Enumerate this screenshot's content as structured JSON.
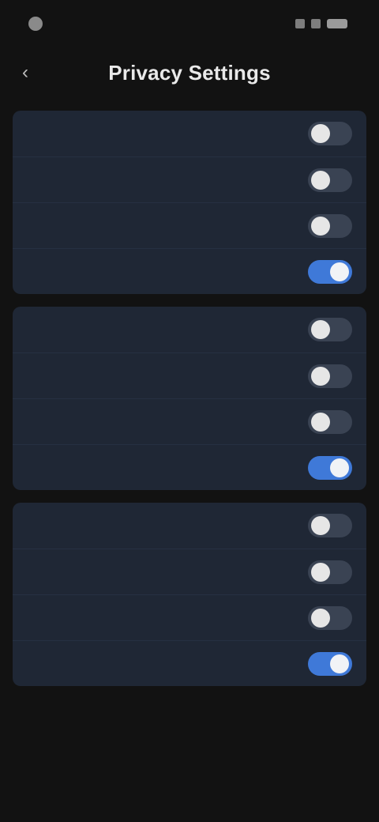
{
  "status_bar": {
    "time": "",
    "right_text": ""
  },
  "header": {
    "title": "Privacy Settings"
  },
  "sections": [
    {
      "title": "",
      "items": [
        {
          "label": "",
          "on": false
        },
        {
          "label": "",
          "on": false
        },
        {
          "label": "",
          "on": false
        },
        {
          "label": "",
          "on": true
        }
      ]
    },
    {
      "title": "",
      "items": [
        {
          "label": "",
          "on": false
        },
        {
          "label": "",
          "on": false
        },
        {
          "label": "",
          "on": false
        },
        {
          "label": "",
          "on": true
        }
      ]
    },
    {
      "title": "",
      "items": [
        {
          "label": "",
          "on": false
        },
        {
          "label": "",
          "on": false
        },
        {
          "label": "",
          "on": false
        },
        {
          "label": "",
          "on": true
        }
      ]
    }
  ],
  "colors": {
    "background": "#121212",
    "group_background": "#1f2735",
    "toggle_off": "#3a4353",
    "toggle_on": "#3f79d8"
  },
  "icons": {
    "status_left_icon": "circle-icon",
    "status_right_icon": "battery-icon",
    "back_icon": "chevron-left-icon"
  }
}
